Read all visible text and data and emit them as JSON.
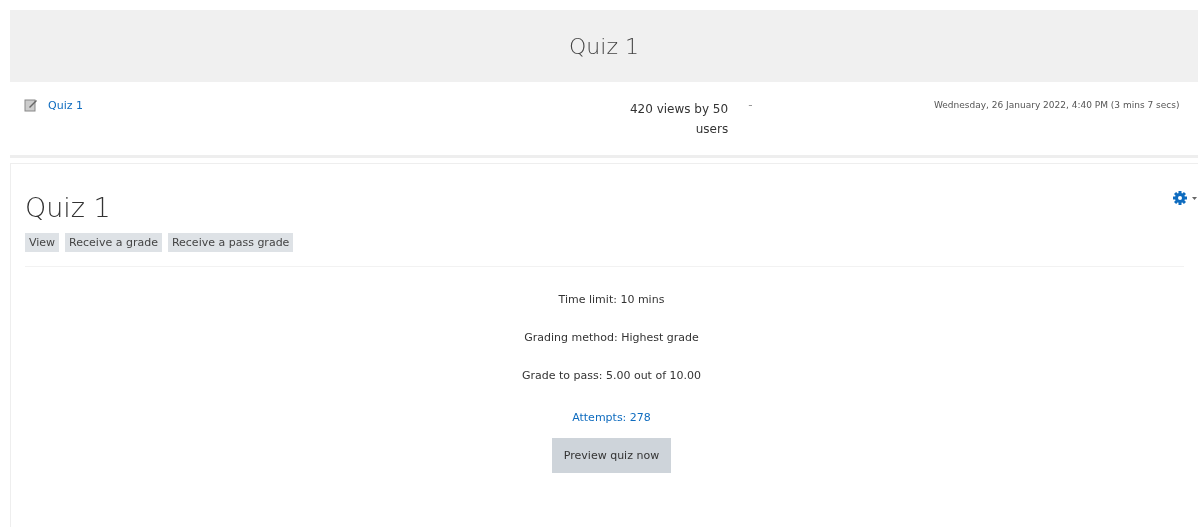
{
  "header": {
    "title": "Quiz 1"
  },
  "log_row": {
    "link": "Quiz 1",
    "views": "420 views by 50 users",
    "separator": "-",
    "last_access": "Wednesday, 26 January 2022, 4:40 PM (3 mins 7 secs)"
  },
  "activity": {
    "title": "Quiz 1",
    "conditions": [
      "View",
      "Receive a grade",
      "Receive a pass grade"
    ],
    "info": [
      "Time limit: 10 mins",
      "Grading method: Highest grade",
      "Grade to pass: 5.00 out of 10.00"
    ],
    "attempts_link": "Attempts: 278",
    "button": "Preview quiz now"
  }
}
